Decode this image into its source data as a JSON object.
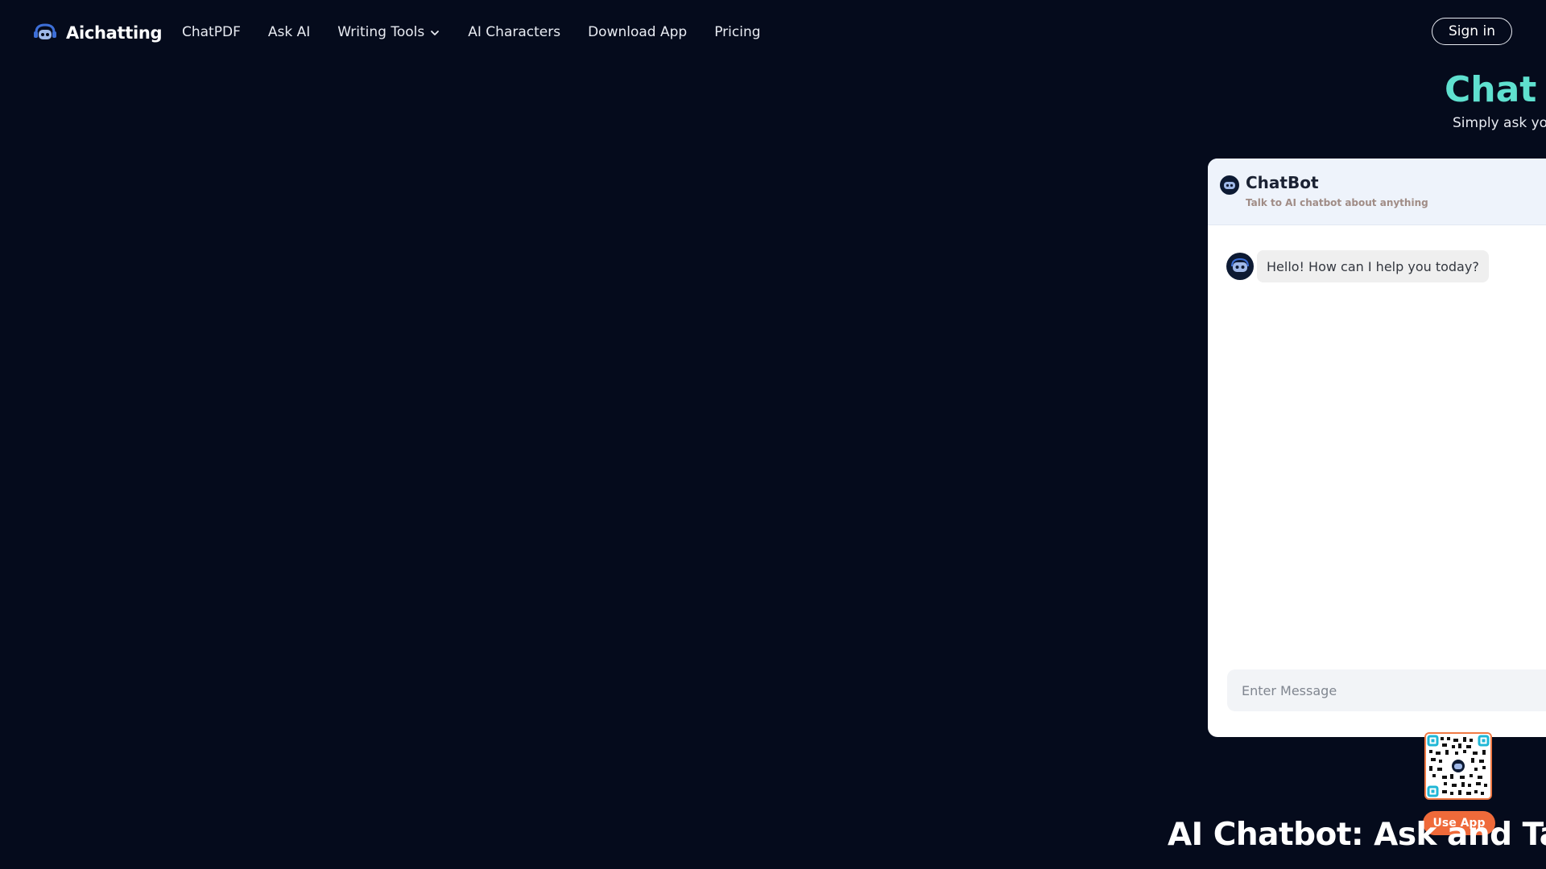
{
  "nav": {
    "logo_text": "Aichatting",
    "links": [
      {
        "label": "ChatPDF"
      },
      {
        "label": "Ask AI"
      },
      {
        "label": "Writing Tools"
      },
      {
        "label": "AI Characters"
      },
      {
        "label": "Download App"
      },
      {
        "label": "Pricing"
      }
    ],
    "signin_label": "Sign in"
  },
  "hero": {
    "title": "Chat w",
    "subtitle": "Simply ask you"
  },
  "chat": {
    "title": "ChatBot",
    "subtitle": "Talk to AI chatbot about anything",
    "messages": [
      {
        "sender": "bot",
        "text": "Hello! How can I help you today?"
      }
    ],
    "input_placeholder": "Enter Message"
  },
  "app_promo": {
    "use_app_label": "Use App"
  },
  "section": {
    "title": "AI Chatbot: Ask and Talk t"
  },
  "colors": {
    "background": "#050b1c",
    "accent_teal": "#5fe0cf",
    "accent_orange": "#ef6a3a"
  }
}
